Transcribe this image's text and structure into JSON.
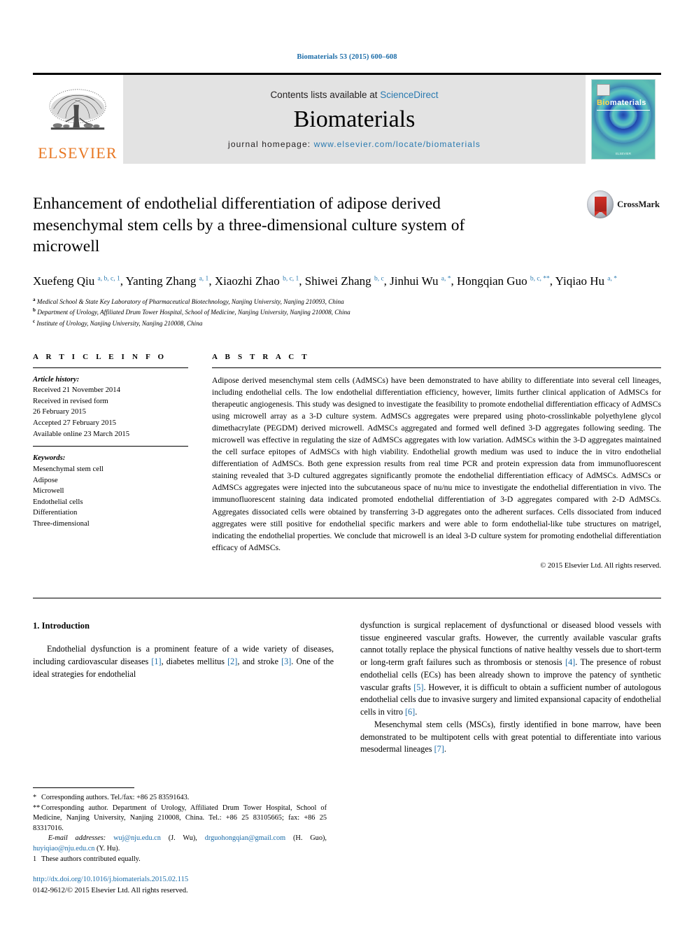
{
  "running_head": "Biomaterials 53 (2015) 600–608",
  "masthead": {
    "contents_prefix": "Contents lists available at ",
    "contents_link": "ScienceDirect",
    "journal_title": "Biomaterials",
    "homepage_prefix": "journal homepage: ",
    "homepage_url": "www.elsevier.com/locate/biomaterials",
    "publisher_logo_text": "ELSEVIER",
    "cover_label_bio": "Bio",
    "cover_label_materials": "materials",
    "cover_footer": "ELSEVIER"
  },
  "article": {
    "title": "Enhancement of endothelial differentiation of adipose derived mesenchymal stem cells by a three-dimensional culture system of microwell",
    "crossmark_label": "CrossMark",
    "authors": [
      {
        "name": "Xuefeng Qiu",
        "marks": "a, b, c, 1",
        "sep": ", "
      },
      {
        "name": "Yanting Zhang",
        "marks": "a, 1",
        "sep": ", "
      },
      {
        "name": "Xiaozhi Zhao",
        "marks": "b, c, 1",
        "sep": ", "
      },
      {
        "name": "Shiwei Zhang",
        "marks": "b, c",
        "sep": ", "
      },
      {
        "name": "Jinhui Wu",
        "marks": "a, *",
        "sep": ", "
      },
      {
        "name": "Hongqian Guo",
        "marks": "b, c, **",
        "sep": ", "
      },
      {
        "name": "Yiqiao Hu",
        "marks": "a, *",
        "sep": ""
      }
    ],
    "affiliations": [
      {
        "mark": "a",
        "text": "Medical School & State Key Laboratory of Pharmaceutical Biotechnology, Nanjing University, Nanjing 210093, China"
      },
      {
        "mark": "b",
        "text": "Department of Urology, Affiliated Drum Tower Hospital, School of Medicine, Nanjing University, Nanjing 210008, China"
      },
      {
        "mark": "c",
        "text": "Institute of Urology, Nanjing University, Nanjing 210008, China"
      }
    ]
  },
  "article_info": {
    "heading": "A R T I C L E  I N F O",
    "history_label": "Article history:",
    "history": [
      "Received 21 November 2014",
      "Received in revised form",
      "26 February 2015",
      "Accepted 27 February 2015",
      "Available online 23 March 2015"
    ],
    "keywords_label": "Keywords:",
    "keywords": [
      "Mesenchymal stem cell",
      "Adipose",
      "Microwell",
      "Endothelial cells",
      "Differentiation",
      "Three-dimensional"
    ]
  },
  "abstract": {
    "heading": "A B S T R A C T",
    "text": "Adipose derived mesenchymal stem cells (AdMSCs) have been demonstrated to have ability to differentiate into several cell lineages, including endothelial cells. The low endothelial differentiation efficiency, however, limits further clinical application of AdMSCs for therapeutic angiogenesis. This study was designed to investigate the feasibility to promote endothelial differentiation efficacy of AdMSCs using microwell array as a 3-D culture system. AdMSCs aggregates were prepared using photo-crosslinkable polyethylene glycol dimethacrylate (PEGDM) derived microwell. AdMSCs aggregated and formed well defined 3-D aggregates following seeding. The microwell was effective in regulating the size of AdMSCs aggregates with low variation. AdMSCs within the 3-D aggregates maintained the cell surface epitopes of AdMSCs with high viability. Endothelial growth medium was used to induce the in vitro endothelial differentiation of AdMSCs. Both gene expression results from real time PCR and protein expression data from immunofluorescent staining revealed that 3-D cultured aggregates significantly promote the endothelial differentiation efficacy of AdMSCs. AdMSCs or AdMSCs aggregates were injected into the subcutaneous space of nu/nu mice to investigate the endothelial differentiation in vivo. The immunofluorescent staining data indicated promoted endothelial differentiation of 3-D aggregates compared with 2-D AdMSCs. Aggregates dissociated cells were obtained by transferring 3-D aggregates onto the adherent surfaces. Cells dissociated from induced aggregates were still positive for endothelial specific markers and were able to form endothelial-like tube structures on matrigel, indicating the endothelial properties. We conclude that microwell is an ideal 3-D culture system for promoting endothelial differentiation efficacy of AdMSCs.",
    "copyright": "© 2015 Elsevier Ltd. All rights reserved."
  },
  "introduction": {
    "section_number": "1.",
    "section_title": "Introduction",
    "left_paragraph_parts": [
      "Endothelial dysfunction is a prominent feature of a wide variety of diseases, including cardiovascular diseases ",
      "[1]",
      ", diabetes mellitus ",
      "[2]",
      ", and stroke ",
      "[3]",
      ". One of the ideal strategies for endothelial"
    ],
    "right_paragraph1_parts": [
      "dysfunction is surgical replacement of dysfunctional or diseased blood vessels with tissue engineered vascular grafts. However, the currently available vascular grafts cannot totally replace the physical functions of native healthy vessels due to short-term or long-term graft failures such as thrombosis or stenosis ",
      "[4]",
      ". The presence of robust endothelial cells (ECs) has been already shown to improve the patency of synthetic vascular grafts ",
      "[5]",
      ". However, it is difficult to obtain a sufficient number of autologous endothelial cells due to invasive surgery and limited expansional capacity of endothelial cells in vitro ",
      "[6]",
      "."
    ],
    "right_paragraph2_parts": [
      "Mesenchymal stem cells (MSCs), firstly identified in bone marrow, have been demonstrated to be multipotent cells with great potential to differentiate into various mesodermal lineages ",
      "[7]",
      "."
    ]
  },
  "footnotes": {
    "corresponding_1_mark": "*",
    "corresponding_1": "Corresponding authors. Tel./fax: +86 25 83591643.",
    "corresponding_2_mark": "**",
    "corresponding_2": "Corresponding author. Department of Urology, Affiliated Drum Tower Hospital, School of Medicine, Nanjing University, Nanjing 210008, China. Tel.: +86 25 83105665; fax: +86 25 83317016.",
    "email_label": "E-mail addresses:",
    "emails": [
      {
        "address": "wuj@nju.edu.cn",
        "owner": " (J. Wu), "
      },
      {
        "address": "drguohongqian@gmail.com",
        "owner": " (H. Guo), "
      },
      {
        "address": "huyiqiao@nju.edu.cn",
        "owner": " (Y. Hu)."
      }
    ],
    "equal_contrib_mark": "1",
    "equal_contrib": "These authors contributed equally.",
    "doi": "http://dx.doi.org/10.1016/j.biomaterials.2015.02.115",
    "issn_line": "0142-9612/© 2015 Elsevier Ltd. All rights reserved."
  },
  "colors": {
    "link_blue": "#1b6ca8",
    "sciencedirect_blue": "#2a7ab0",
    "elsevier_orange": "#E87722",
    "cover_teal": "#3aa8a0"
  }
}
